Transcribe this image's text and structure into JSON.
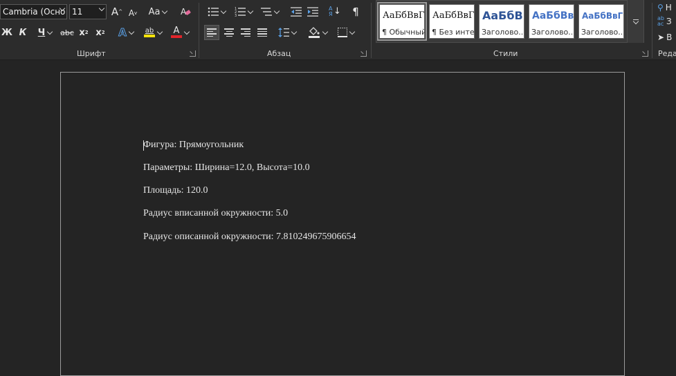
{
  "font": {
    "family_value": "Cambria (Осно",
    "size_value": "11",
    "grow_label": "A",
    "shrink_label": "A",
    "case_label": "Aa",
    "bold_label": "Ж",
    "italic_label": "К",
    "underline_label": "Ч",
    "strike_label": "abc",
    "subscript_label": "x",
    "subscript_mark": "2",
    "superscript_label": "x",
    "superscript_mark": "2",
    "effects_label": "A",
    "highlight_label": "ab",
    "color_label": "A",
    "group_label": "Шрифт"
  },
  "paragraph": {
    "group_label": "Абзац",
    "sort_label": "АЯ",
    "marks_label": "¶"
  },
  "styles": {
    "group_label": "Стили",
    "cards": [
      {
        "sample": "АаБбВвГ",
        "name": "¶ Обычный"
      },
      {
        "sample": "АаБбВвГ",
        "name": "¶ Без инте..."
      },
      {
        "sample": "АаБбВв",
        "name": "Заголово..."
      },
      {
        "sample": "АаБбВвГ",
        "name": "Заголово..."
      },
      {
        "sample": "АаБбВвГг",
        "name": "Заголово..."
      }
    ]
  },
  "editing": {
    "group_label": "Реда",
    "find_label": "Н",
    "replace_label": "З",
    "select_label": "В"
  },
  "colors": {
    "highlight": "#f4e20a",
    "font_color": "#e2242a",
    "heading1": "#2f5496",
    "heading2": "#4472c4"
  },
  "document": {
    "lines": [
      "Фигура: Прямоугольник",
      "Параметры: Ширина=12.0, Высота=10.0",
      "Площадь: 120.0",
      "Радиус вписанной окружности: 5.0",
      "Радиус описанной окружности: 7.810249675906654"
    ]
  }
}
